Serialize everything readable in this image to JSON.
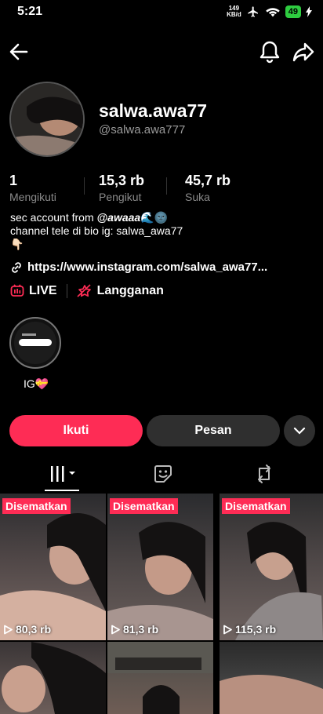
{
  "status_bar": {
    "time": "5:21",
    "net_speed_value": "149",
    "net_speed_unit": "KB/d",
    "battery": "49"
  },
  "profile": {
    "username": "salwa.awa77",
    "handle": "@salwa.awa777"
  },
  "stats": [
    {
      "value": "1",
      "label": "Mengikuti"
    },
    {
      "value": "15,3 rb",
      "label": "Pengikut"
    },
    {
      "value": "45,7 rb",
      "label": "Suka"
    }
  ],
  "bio": {
    "line1_prefix": "sec account from ",
    "line1_mention": "@awaaa",
    "line1_emoji": "🌊🌚",
    "line2": "channel tele di bio ig: salwa_awa77",
    "line3_emoji": "👇🏻"
  },
  "link": "https://www.instagram.com/salwa_awa77...",
  "live_label": "LIVE",
  "subscription_label": "Langganan",
  "highlight": {
    "label": "IG💝"
  },
  "buttons": {
    "follow": "Ikuti",
    "message": "Pesan"
  },
  "pinned_label": "Disematkan",
  "videos": [
    {
      "views": "80,3 rb",
      "pinned": true
    },
    {
      "views": "81,3 rb",
      "pinned": true
    },
    {
      "views": "115,3 rb",
      "pinned": true
    }
  ],
  "colors": {
    "accent": "#fe2c55",
    "button_dark": "#2f2f2f",
    "muted_text": "#8a8a8a"
  },
  "icons": [
    "back-arrow-icon",
    "bell-icon",
    "share-arrow-icon",
    "link-icon",
    "live-icon",
    "subscription-icon",
    "chevron-down-icon",
    "videos-grid-icon",
    "sticker-icon",
    "repost-icon",
    "play-icon"
  ]
}
